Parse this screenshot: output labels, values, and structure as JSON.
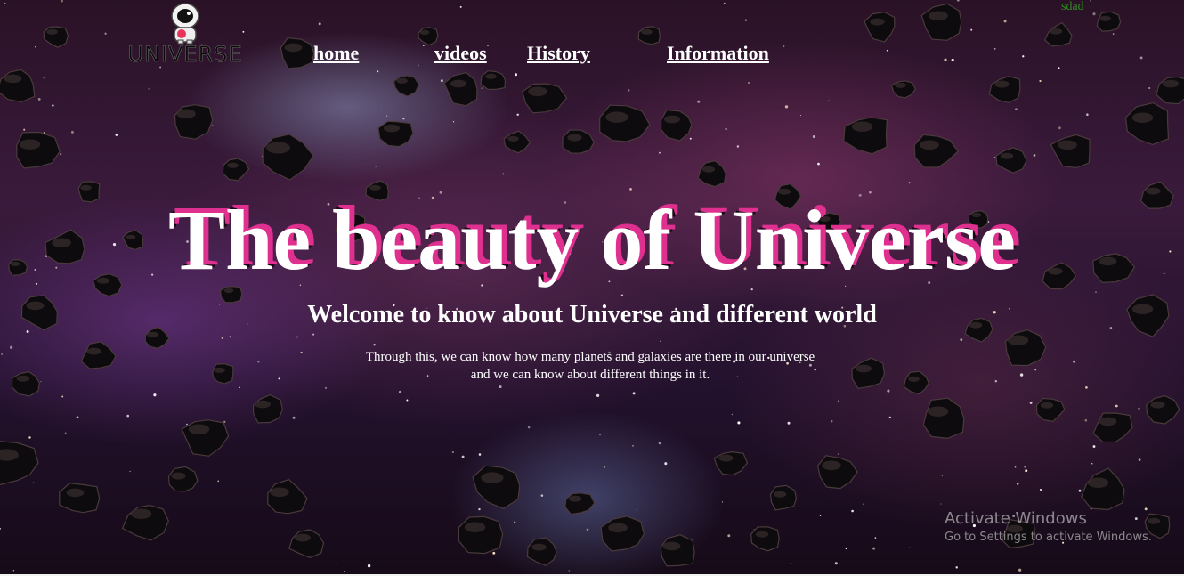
{
  "logo": {
    "text": "UNIVERSE",
    "icon": "astronaut-icon"
  },
  "nav": {
    "items": [
      {
        "label": "home"
      },
      {
        "label": "videos"
      },
      {
        "label": "History"
      },
      {
        "label": "Information"
      }
    ]
  },
  "corner_text": "sdad",
  "hero": {
    "title": "The beauty of Universe",
    "subtitle": "Welcome to know about Universe and different world",
    "description": "Through this, we can know how many planets and galaxies are there in our universe and we can know about different things in it."
  },
  "watermark": {
    "title": "Activate Windows",
    "subtitle": "Go to Settings to activate Windows."
  },
  "colors": {
    "title_shadow": "#e0308f",
    "text": "#ffffff",
    "corner_text": "#2e8b1e"
  }
}
